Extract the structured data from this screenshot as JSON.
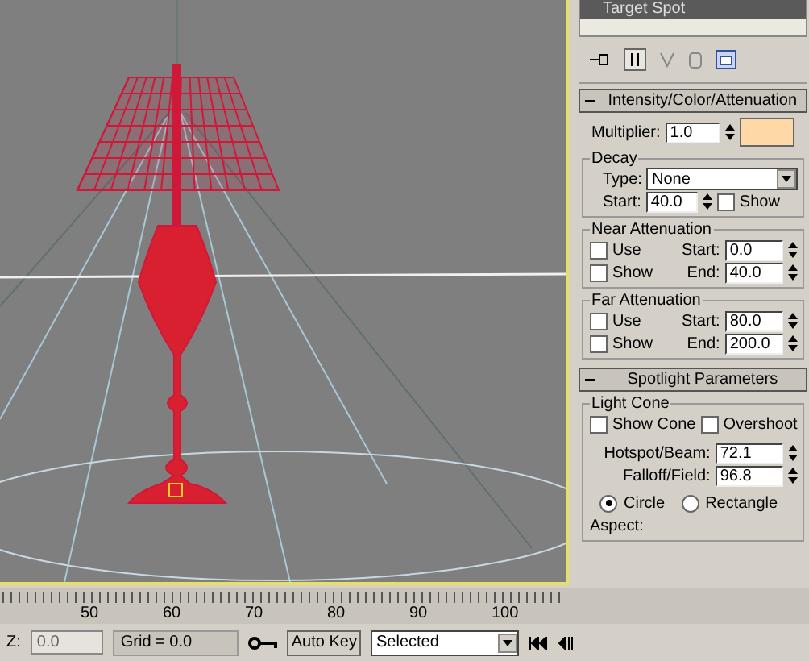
{
  "viewport": {
    "active": true
  },
  "panel": {
    "object_list": [
      "Target Spot"
    ],
    "intensity": {
      "title": "Intensity/Color/Attenuation",
      "multiplier_label": "Multiplier:",
      "multiplier": "1.0",
      "color": "#ffd8a8"
    },
    "decay": {
      "title": "Decay",
      "type_label": "Type:",
      "type": "None",
      "start_label": "Start:",
      "start": "40.0",
      "show": {
        "label": "Show",
        "checked": false
      }
    },
    "attenuation": [
      {
        "title": "Near Attenuation",
        "use": {
          "label": "Use",
          "checked": false
        },
        "show": {
          "label": "Show",
          "checked": false
        },
        "start_label": "Start:",
        "start": "0.0",
        "end_label": "End:",
        "end": "40.0"
      },
      {
        "title": "Far Attenuation",
        "use": {
          "label": "Use",
          "checked": false
        },
        "show": {
          "label": "Show",
          "checked": false
        },
        "start_label": "Start:",
        "start": "80.0",
        "end_label": "End:",
        "end": "200.0"
      }
    ],
    "spotlight": {
      "title": "Spotlight Parameters",
      "group": "Light Cone",
      "show_cone": {
        "label": "Show Cone",
        "checked": false
      },
      "overshoot": {
        "label": "Overshoot",
        "checked": false
      },
      "hotspot_label": "Hotspot/Beam:",
      "hotspot": "72.1",
      "falloff_label": "Falloff/Field:",
      "falloff": "96.8",
      "shapes": [
        {
          "label": "Circle",
          "selected": true
        },
        {
          "label": "Rectangle",
          "selected": false
        }
      ],
      "aspect_label": "Aspect:"
    }
  },
  "timeline": {
    "ticks": [
      "50",
      "60",
      "70",
      "80",
      "90",
      "100"
    ]
  },
  "status": {
    "z_label": "Z:",
    "z_value": "0.0",
    "grid": "Grid = 0.0",
    "auto_key": "Auto Key",
    "key_filter": "Selected"
  }
}
